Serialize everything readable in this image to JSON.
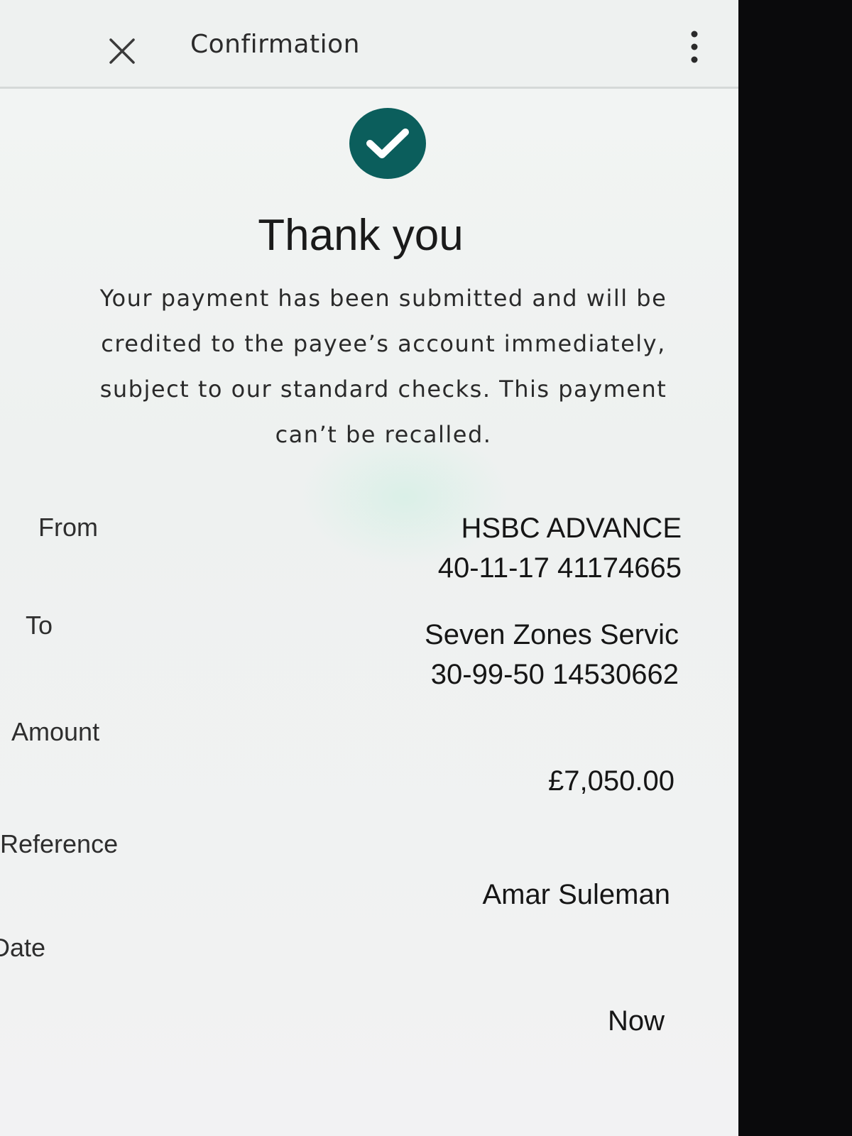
{
  "appbar": {
    "title": "Confirmation",
    "close_icon": "close-icon",
    "more_icon": "more-vertical-icon"
  },
  "status": {
    "icon": "check-circle-icon",
    "icon_color": "#0b5e5c",
    "title": "Thank you",
    "message_lines": [
      "Your payment has been submitted and will be",
      "credited to the payee’s account immediately,",
      "subject to our standard checks. This payment",
      "can’t be recalled."
    ]
  },
  "details": {
    "from": {
      "label": "From",
      "line1": "HSBC ADVANCE",
      "line2": "40-11-17 41174665"
    },
    "to": {
      "label": "To",
      "line1": "Seven Zones Servic",
      "line2": "30-99-50 14530662"
    },
    "amount": {
      "label": "Amount",
      "value": "£7,050.00"
    },
    "reference": {
      "label": "Reference",
      "value": "Amar Suleman"
    },
    "date": {
      "label": "Date",
      "value": "Now"
    }
  }
}
